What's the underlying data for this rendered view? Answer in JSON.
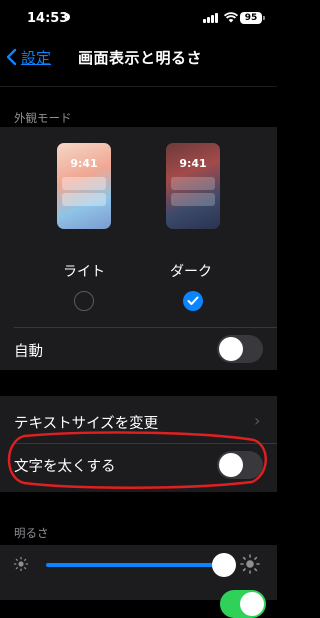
{
  "status": {
    "time": "14:53",
    "battery": "95"
  },
  "nav": {
    "back_label": "設定",
    "title": "画面表示と明るさ"
  },
  "appearance": {
    "header": "外観モード",
    "light": {
      "label": "ライト",
      "preview_time": "9:41",
      "selected": false
    },
    "dark": {
      "label": "ダーク",
      "preview_time": "9:41",
      "selected": true
    },
    "auto_label": "自動",
    "auto_on": false
  },
  "text": {
    "text_size_label": "テキストサイズを変更",
    "bold_text_label": "文字を太くする",
    "bold_on": false
  },
  "brightness": {
    "header": "明るさ",
    "level": 0.98
  },
  "colors": {
    "accent": "#0a84ff",
    "toggle_on": "#30d158",
    "annotation": "#e02020"
  }
}
